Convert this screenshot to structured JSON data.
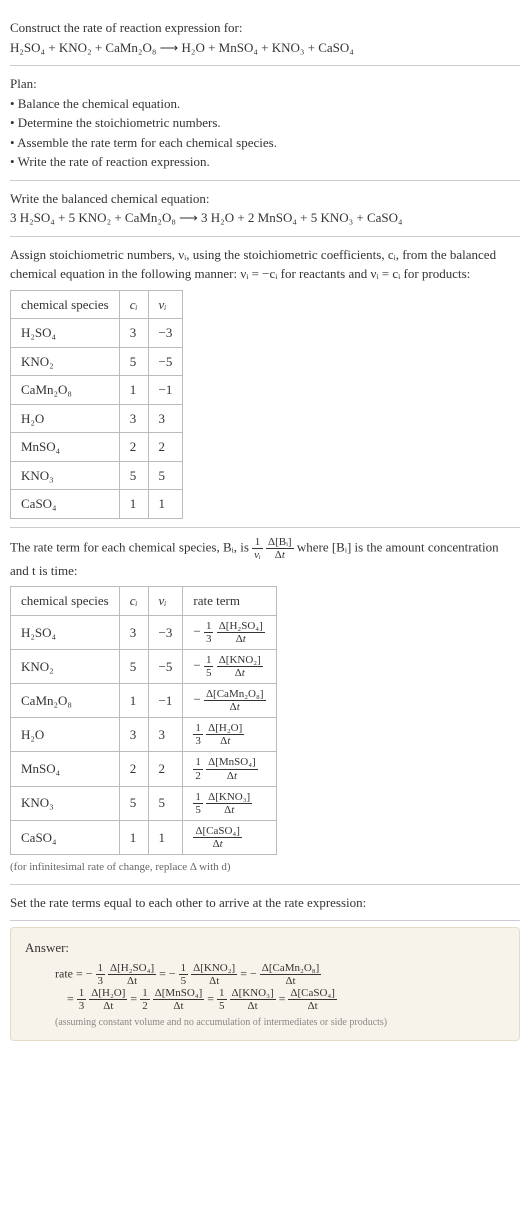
{
  "intro": {
    "title": "Construct the rate of reaction expression for:",
    "equation": "H₂SO₄ + KNO₂ + CaMn₂O₈  ⟶  H₂O + MnSO₄ + KNO₃ + CaSO₄"
  },
  "plan": {
    "heading": "Plan:",
    "items": [
      "• Balance the chemical equation.",
      "• Determine the stoichiometric numbers.",
      "• Assemble the rate term for each chemical species.",
      "• Write the rate of reaction expression."
    ]
  },
  "balanced": {
    "heading": "Write the balanced chemical equation:",
    "equation": "3 H₂SO₄ + 5 KNO₂ + CaMn₂O₈  ⟶  3 H₂O + 2 MnSO₄ + 5 KNO₃ + CaSO₄"
  },
  "stoich": {
    "intro": "Assign stoichiometric numbers, νᵢ, using the stoichiometric coefficients, cᵢ, from the balanced chemical equation in the following manner: νᵢ = −cᵢ for reactants and νᵢ = cᵢ for products:",
    "headers": [
      "chemical species",
      "cᵢ",
      "νᵢ"
    ],
    "rows": [
      {
        "species": "H₂SO₄",
        "c": "3",
        "v": "−3"
      },
      {
        "species": "KNO₂",
        "c": "5",
        "v": "−5"
      },
      {
        "species": "CaMn₂O₈",
        "c": "1",
        "v": "−1"
      },
      {
        "species": "H₂O",
        "c": "3",
        "v": "3"
      },
      {
        "species": "MnSO₄",
        "c": "2",
        "v": "2"
      },
      {
        "species": "KNO₃",
        "c": "5",
        "v": "5"
      },
      {
        "species": "CaSO₄",
        "c": "1",
        "v": "1"
      }
    ]
  },
  "rateTerm": {
    "introPrefix": "The rate term for each chemical species, Bᵢ, is ",
    "introSuffix": " where [Bᵢ] is the amount concentration and t is time:",
    "headers": [
      "chemical species",
      "cᵢ",
      "νᵢ",
      "rate term"
    ],
    "rows": [
      {
        "species": "H₂SO₄",
        "c": "3",
        "v": "−3",
        "coefNum": "1",
        "coefDen": "3",
        "deltaSpecies": "Δ[H₂SO₄]",
        "neg": true
      },
      {
        "species": "KNO₂",
        "c": "5",
        "v": "−5",
        "coefNum": "1",
        "coefDen": "5",
        "deltaSpecies": "Δ[KNO₂]",
        "neg": true
      },
      {
        "species": "CaMn₂O₈",
        "c": "1",
        "v": "−1",
        "coefNum": "",
        "coefDen": "",
        "deltaSpecies": "Δ[CaMn₂O₈]",
        "neg": true
      },
      {
        "species": "H₂O",
        "c": "3",
        "v": "3",
        "coefNum": "1",
        "coefDen": "3",
        "deltaSpecies": "Δ[H₂O]",
        "neg": false
      },
      {
        "species": "MnSO₄",
        "c": "2",
        "v": "2",
        "coefNum": "1",
        "coefDen": "2",
        "deltaSpecies": "Δ[MnSO₄]",
        "neg": false
      },
      {
        "species": "KNO₃",
        "c": "5",
        "v": "5",
        "coefNum": "1",
        "coefDen": "5",
        "deltaSpecies": "Δ[KNO₃]",
        "neg": false
      },
      {
        "species": "CaSO₄",
        "c": "1",
        "v": "1",
        "coefNum": "",
        "coefDen": "",
        "deltaSpecies": "Δ[CaSO₄]",
        "neg": false
      }
    ],
    "note": "(for infinitesimal rate of change, replace Δ with d)"
  },
  "setEqual": {
    "text": "Set the rate terms equal to each other to arrive at the rate expression:"
  },
  "answer": {
    "label": "Answer:",
    "rateLabel": "rate",
    "terms": [
      {
        "neg": true,
        "num": "1",
        "den": "3",
        "delta": "Δ[H₂SO₄]"
      },
      {
        "neg": true,
        "num": "1",
        "den": "5",
        "delta": "Δ[KNO₂]"
      },
      {
        "neg": true,
        "num": "",
        "den": "",
        "delta": "Δ[CaMn₂O₈]"
      },
      {
        "neg": false,
        "num": "1",
        "den": "3",
        "delta": "Δ[H₂O]"
      },
      {
        "neg": false,
        "num": "1",
        "den": "2",
        "delta": "Δ[MnSO₄]"
      },
      {
        "neg": false,
        "num": "1",
        "den": "5",
        "delta": "Δ[KNO₃]"
      },
      {
        "neg": false,
        "num": "",
        "den": "",
        "delta": "Δ[CaSO₄]"
      }
    ],
    "deltaDen": "Δt",
    "note": "(assuming constant volume and no accumulation of intermediates or side products)"
  }
}
